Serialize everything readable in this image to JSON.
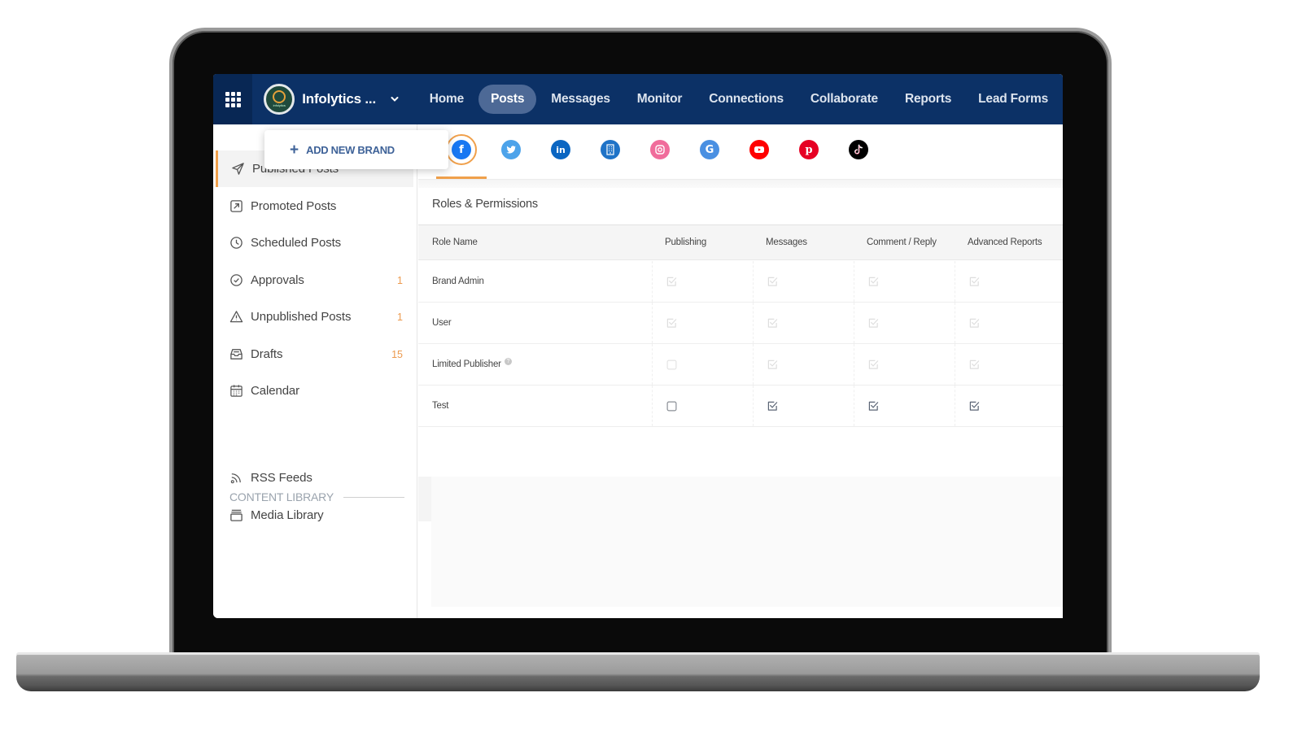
{
  "topnav": {
    "apps_icon": "grid-icon",
    "brand_name": "Infolytics ...",
    "items": [
      {
        "label": "Home",
        "active": false
      },
      {
        "label": "Posts",
        "active": true
      },
      {
        "label": "Messages",
        "active": false
      },
      {
        "label": "Monitor",
        "active": false
      },
      {
        "label": "Connections",
        "active": false
      },
      {
        "label": "Collaborate",
        "active": false
      },
      {
        "label": "Reports",
        "active": false
      },
      {
        "label": "Lead Forms",
        "active": false
      }
    ]
  },
  "brand_dropdown": {
    "add_label": "ADD NEW BRAND",
    "plus_glyph": "+"
  },
  "sidebar": {
    "items": [
      {
        "label": "Published Posts",
        "icon": "paper-plane-icon",
        "count": "",
        "active": true
      },
      {
        "label": "Promoted Posts",
        "icon": "arrow-up-right-box-icon",
        "count": "",
        "active": false
      },
      {
        "label": "Scheduled Posts",
        "icon": "clock-icon",
        "count": "",
        "active": false
      },
      {
        "label": "Approvals",
        "icon": "check-circle-icon",
        "count": "1",
        "active": false
      },
      {
        "label": "Unpublished Posts",
        "icon": "warning-triangle-icon",
        "count": "1",
        "active": false
      },
      {
        "label": "Drafts",
        "icon": "inbox-tray-icon",
        "count": "15",
        "active": false
      },
      {
        "label": "Calendar",
        "icon": "calendar-icon",
        "count": "",
        "active": false
      }
    ],
    "section_title": "CONTENT LIBRARY",
    "library_items": [
      {
        "label": "RSS Feeds",
        "icon": "rss-icon"
      },
      {
        "label": "Media Library",
        "icon": "media-library-icon"
      }
    ]
  },
  "social_networks": [
    {
      "name": "facebook",
      "color": "#1877f2",
      "active": true
    },
    {
      "name": "twitter",
      "color": "#4da3ea",
      "active": false
    },
    {
      "name": "linkedin",
      "color": "#0b66c2",
      "active": false
    },
    {
      "name": "google-business",
      "color": "#1f73c7",
      "active": false
    },
    {
      "name": "instagram",
      "color": "#f06c9b",
      "active": false
    },
    {
      "name": "google",
      "color": "#4a90e2",
      "active": false
    },
    {
      "name": "youtube",
      "color": "#ff0000",
      "active": false
    },
    {
      "name": "pinterest",
      "color": "#e60023",
      "active": false
    },
    {
      "name": "tiktok",
      "color": "#000000",
      "active": false
    }
  ],
  "roles_panel": {
    "title": "Roles & Permissions",
    "columns": [
      "Role Name",
      "Publishing",
      "Messages",
      "Comment / Reply",
      "Advanced Reports"
    ],
    "rows": [
      {
        "role": "Brand Admin",
        "help": false,
        "perms": [
          {
            "checked": true,
            "disabled": true
          },
          {
            "checked": true,
            "disabled": true
          },
          {
            "checked": true,
            "disabled": true
          },
          {
            "checked": true,
            "disabled": true
          }
        ]
      },
      {
        "role": "User",
        "help": false,
        "perms": [
          {
            "checked": true,
            "disabled": true
          },
          {
            "checked": true,
            "disabled": true
          },
          {
            "checked": true,
            "disabled": true
          },
          {
            "checked": true,
            "disabled": true
          }
        ]
      },
      {
        "role": "Limited Publisher",
        "help": true,
        "perms": [
          {
            "checked": false,
            "disabled": true
          },
          {
            "checked": true,
            "disabled": true
          },
          {
            "checked": true,
            "disabled": true
          },
          {
            "checked": true,
            "disabled": true
          }
        ]
      },
      {
        "role": "Test",
        "help": false,
        "perms": [
          {
            "checked": false,
            "disabled": false
          },
          {
            "checked": true,
            "disabled": false
          },
          {
            "checked": true,
            "disabled": false
          },
          {
            "checked": true,
            "disabled": false
          }
        ]
      }
    ]
  },
  "colors": {
    "nav_bg": "#0c3166",
    "accent_orange": "#f0a04b",
    "link_blue": "#3e6298"
  }
}
